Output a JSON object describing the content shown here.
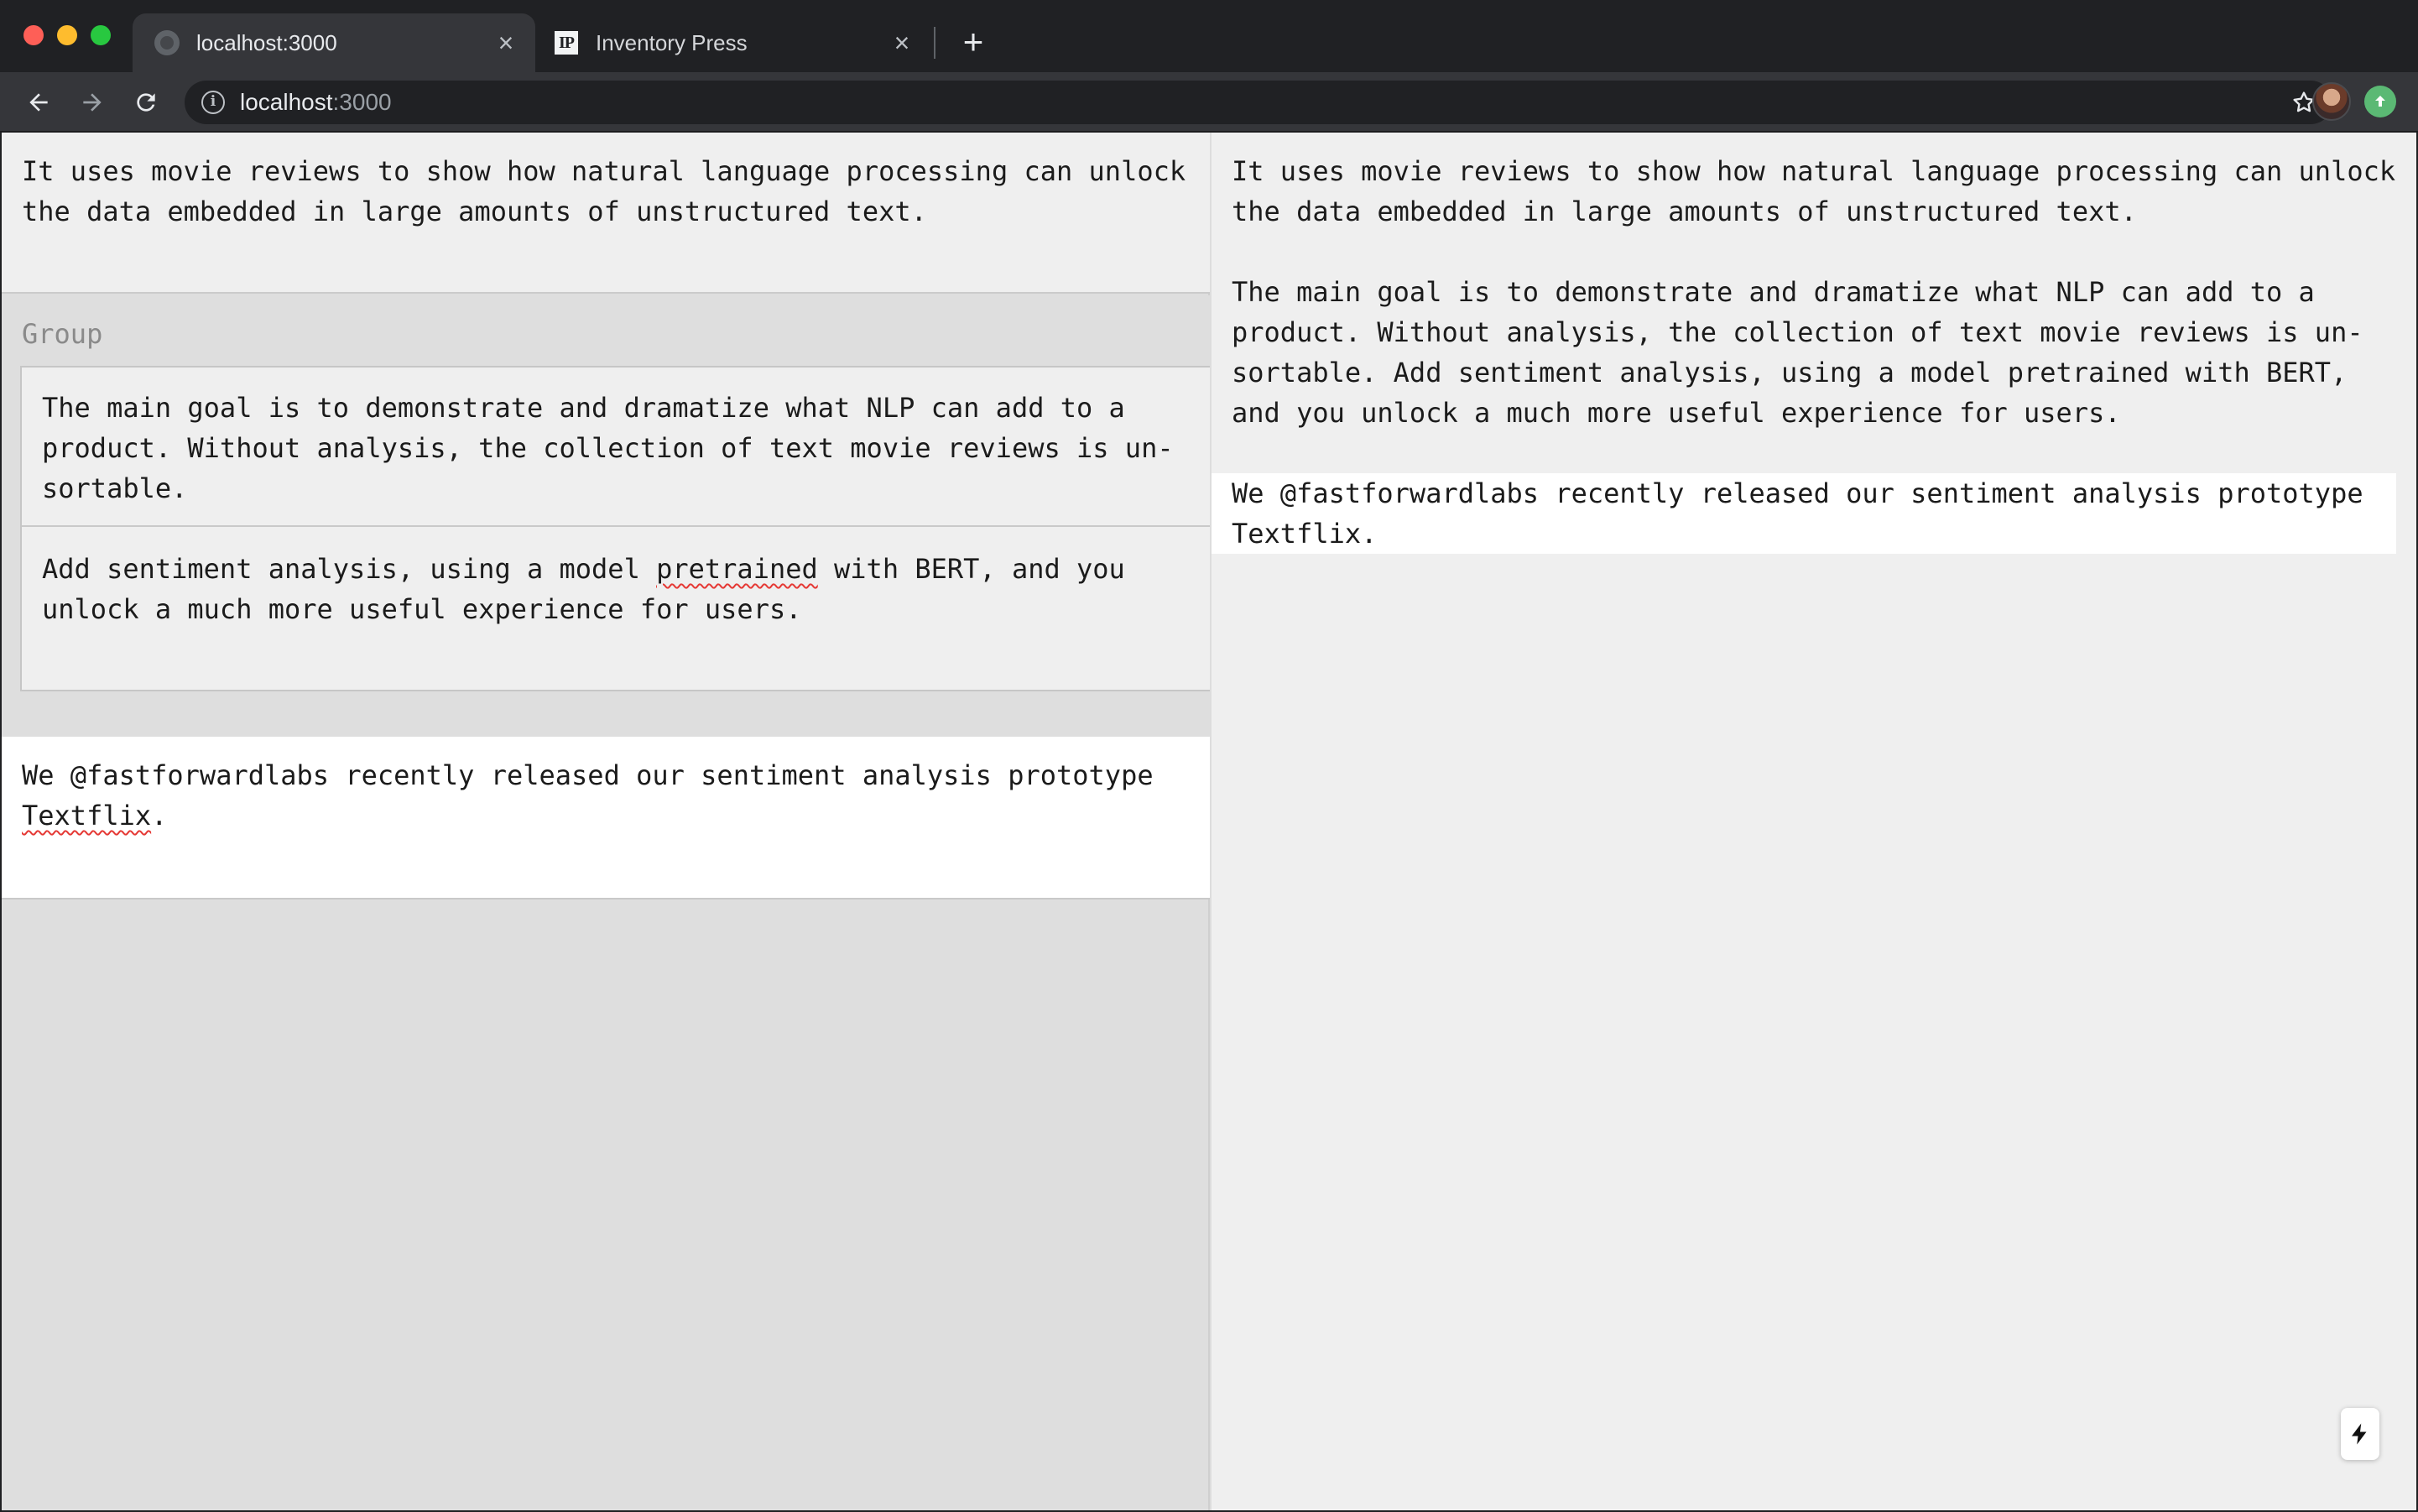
{
  "browser": {
    "tabs": [
      {
        "title": "localhost:3000",
        "active": true,
        "favicon": "globe-icon"
      },
      {
        "title": "Inventory Press",
        "active": false,
        "favicon": "inventory-press-logo",
        "logo_text": "IP"
      }
    ],
    "address_bar": {
      "host": "localhost",
      "port": ":3000"
    }
  },
  "editor": {
    "intro": "It uses movie reviews to show how natural language processing can unlock the data embedded in large amounts of unstructured text.",
    "group": {
      "label": "Group",
      "block1": "The main goal is to demonstrate and dramatize what NLP can add to a product. Without analysis, the collection of text movie reviews is un-sortable.",
      "block2_before": "Add sentiment analysis, using a model ",
      "block2_misspelled": "pretrained",
      "block2_after": " with BERT, and you unlock a much more useful experience for users."
    },
    "tweet_before": "We @fastforwardlabs recently released our sentiment analysis prototype ",
    "tweet_misspelled": "Textflix",
    "tweet_after": "."
  },
  "preview": {
    "para1": "It uses movie reviews to show how natural language processing can unlock the data embedded in large amounts of unstructured text.",
    "para2": "The main goal is to demonstrate and dramatize what NLP can add to a product. Without analysis, the collection of text movie reviews is un-sortable. Add sentiment analysis, using a model pretrained with BERT, and you unlock a much more useful experience for users.",
    "para3": "We @fastforwardlabs recently released our sentiment analysis prototype Textflix."
  },
  "colors": {
    "chrome_bg": "#202124",
    "active_tab": "#35363a",
    "spellcheck": "#e53935",
    "update_green": "#5bb974"
  }
}
